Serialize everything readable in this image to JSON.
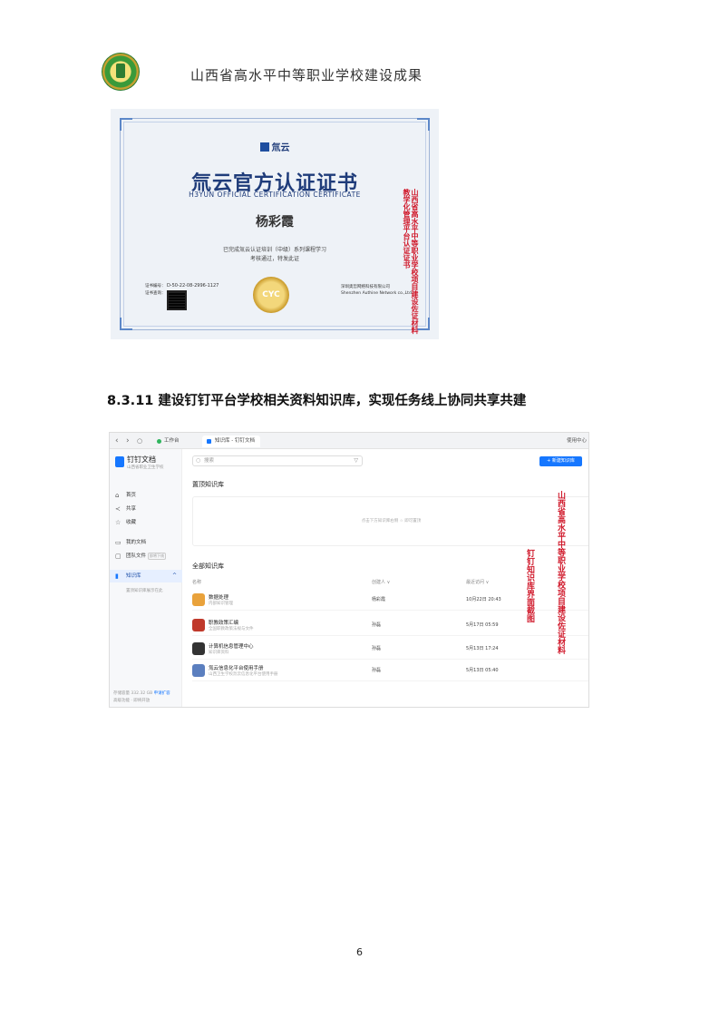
{
  "header": {
    "title": "山西省高水平中等职业学校建设成果",
    "logo_icon": "school-emblem-icon"
  },
  "certificate": {
    "brand": "氚云",
    "title": "氚云官方认证证书",
    "subtitle": "H3YUN OFFICIAL CERTIFICATION CERTIFICATE",
    "name": "杨彩霞",
    "line1": "已完成氚云认证培训（中级）系列课程学习",
    "line2": "考核通过，特发此证",
    "cert_no_label": "证书编号：",
    "cert_no": "D-50-22-08-2996-1127",
    "query_label": "证书查询：",
    "seal": "CYC",
    "company_cn": "深圳奥哲网络科技有限公司",
    "company_en": "Shenzhen Authine Network co.,Ltd",
    "stamp": "山西省高水平中等职业学校项目建设佐证材料 教学化管理平台认证证书"
  },
  "section": {
    "heading": "8.3.11 建设钉钉平台学校相关资料知识库，实现任务线上协同共享共建"
  },
  "app": {
    "topbar": {
      "tab_workbench": "工作台",
      "tab_docs": "知识库 - 钉钉文档",
      "right": "使用中心"
    },
    "sidebar": {
      "title": "钉钉文档",
      "subtitle": "山西省职业卫生学校",
      "items": [
        {
          "label": "首页",
          "icon": "home-icon"
        },
        {
          "label": "共享",
          "icon": "share-icon"
        },
        {
          "label": "收藏",
          "icon": "star-icon"
        },
        {
          "label": "我的文档",
          "icon": "folder-icon"
        },
        {
          "label": "团队文件",
          "icon": "team-folder-icon",
          "badge": "即将下线"
        },
        {
          "label": "知识库",
          "icon": "knowledge-base-icon"
        }
      ],
      "hint": "置顶知识库展示在此",
      "footer1": "存储容量 332.32 GB",
      "footer1_link": "申请扩容",
      "footer2": "高级功能 · 即将开放"
    },
    "main": {
      "search_placeholder": "搜索",
      "new_button": "+ 新建知识库",
      "pinned_heading": "置顶知识库",
      "pinned_hint": "点击下方知识库右侧 ☆ 即可置顶",
      "all_heading": "全部知识库",
      "columns": {
        "name": "名称",
        "creator": "创建人 ∨",
        "modified": "最近访问 ∨"
      },
      "rows": [
        {
          "name": "数据处理",
          "desc": "内部知识管理",
          "creator": "杨彩霞",
          "date": "10月22日 20:43",
          "color": "#e9a23b"
        },
        {
          "name": "职教政策汇编",
          "desc": "全国职教政策法规与文件",
          "creator": "孙磊",
          "date": "5月17日 05:59",
          "color": "#c0392b"
        },
        {
          "name": "计算机信息管理中心",
          "desc": "知识库资料",
          "creator": "孙磊",
          "date": "5月13日 17:24",
          "color": "#333333"
        },
        {
          "name": "氚云信息化平台使用手册",
          "desc": "山西卫生学校氚云信息化平台使用手册",
          "creator": "孙磊",
          "date": "5月13日 05:40",
          "color": "#5b7fbf"
        }
      ]
    },
    "stamp_left": "钉钉知识库界面截图",
    "stamp_right": "山西省高水平中等职业学校项目建设佐证材料"
  },
  "page_number": "6"
}
